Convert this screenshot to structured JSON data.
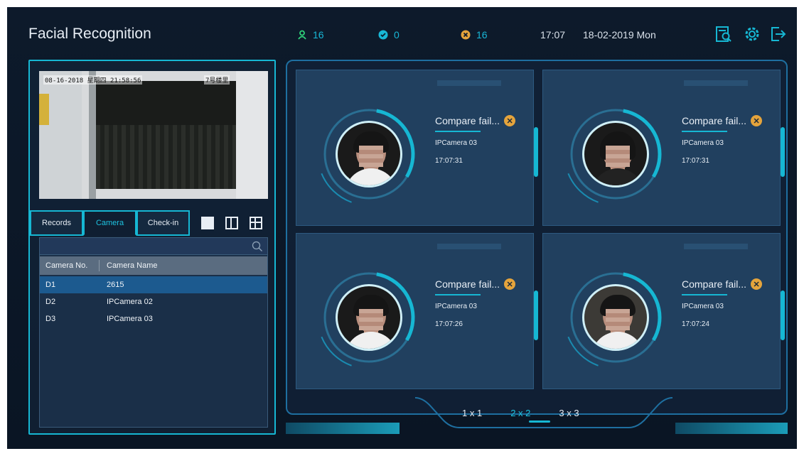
{
  "header": {
    "title": "Facial Recognition",
    "stats": [
      {
        "icon": "person-icon",
        "value": "16"
      },
      {
        "icon": "check-circle-icon",
        "value": "0"
      },
      {
        "icon": "x-circle-icon",
        "value": "16"
      }
    ],
    "time": "17:07",
    "date": "18-02-2019 Mon",
    "actions": [
      "search-record-icon",
      "settings-icon",
      "exit-icon"
    ]
  },
  "preview": {
    "osd_left": "08-16-2018 星期四 21:58:56",
    "osd_right": "7号楼里"
  },
  "tabs": [
    {
      "label": "Records",
      "active": false
    },
    {
      "label": "Camera",
      "active": true
    },
    {
      "label": "Check-in",
      "active": false
    }
  ],
  "camera_list": {
    "search_placeholder": "",
    "columns": [
      "Camera No.",
      "Camera Name"
    ],
    "rows": [
      {
        "no": "D1",
        "name": "2615",
        "selected": true
      },
      {
        "no": "D2",
        "name": "IPCamera 02",
        "selected": false
      },
      {
        "no": "D3",
        "name": "IPCamera 03",
        "selected": false
      }
    ]
  },
  "cards": [
    {
      "status": "Compare fail...",
      "camera": "IPCamera 03",
      "time": "17:07:31"
    },
    {
      "status": "Compare fail...",
      "camera": "IPCamera 03",
      "time": "17:07:31"
    },
    {
      "status": "Compare fail...",
      "camera": "IPCamera 03",
      "time": "17:07:26"
    },
    {
      "status": "Compare fail...",
      "camera": "IPCamera 03",
      "time": "17:07:24"
    }
  ],
  "layouts": [
    {
      "label": "1 x 1",
      "active": false
    },
    {
      "label": "2 x 2",
      "active": true
    },
    {
      "label": "3 x 3",
      "active": false
    }
  ],
  "colors": {
    "accent": "#16b7d3",
    "fail": "#e5a43c",
    "background": "#0d1a2b"
  }
}
